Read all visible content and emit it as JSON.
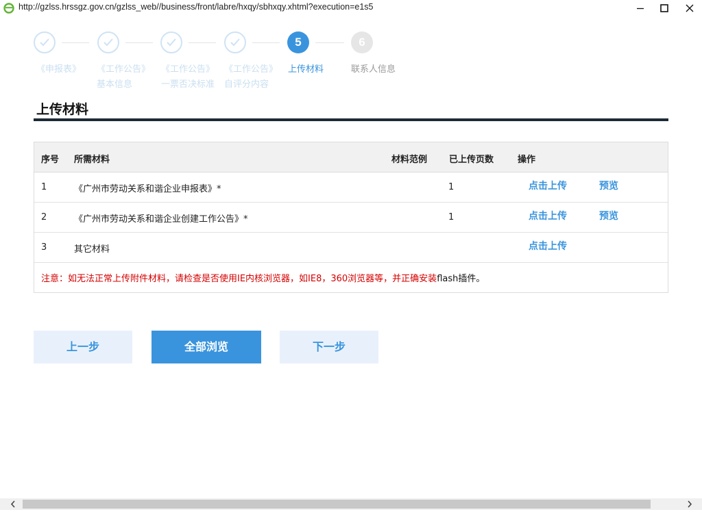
{
  "window": {
    "url": "http://gzlss.hrssgz.gov.cn/gzlss_web//business/front/labre/hxqy/sbhxqy.xhtml?execution=e1s5"
  },
  "steps": [
    {
      "number": "",
      "line1": "《申报表》",
      "line2": "",
      "state": "done"
    },
    {
      "number": "",
      "line1": "《工作公告》",
      "line2": "基本信息",
      "state": "done"
    },
    {
      "number": "",
      "line1": "《工作公告》",
      "line2": "一票否决标准",
      "state": "done"
    },
    {
      "number": "",
      "line1": "《工作公告》",
      "line2": "自评分内容",
      "state": "done"
    },
    {
      "number": "5",
      "line1": "上传材料",
      "line2": "",
      "state": "active"
    },
    {
      "number": "6",
      "line1": "联系人信息",
      "line2": "",
      "state": "todo"
    }
  ],
  "section": {
    "title": "上传材料"
  },
  "table": {
    "headers": {
      "no": "序号",
      "material": "所需材料",
      "example": "材料范例",
      "pages": "已上传页数",
      "action": "操作"
    },
    "rows": [
      {
        "no": "1",
        "material": "《广州市劳动关系和谐企业申报表》*",
        "pages": "1",
        "upload": "点击上传",
        "preview": "预览"
      },
      {
        "no": "2",
        "material": "《广州市劳动关系和谐企业创建工作公告》*",
        "pages": "1",
        "upload": "点击上传",
        "preview": "预览"
      },
      {
        "no": "3",
        "material": "其它材料",
        "pages": "",
        "upload": "点击上传",
        "preview": ""
      }
    ],
    "note_red": "注意：如无法正常上传附件材料，请检查是否使用IE内核浏览器，如IE8，360浏览器等，并正确安装",
    "note_black": "flash插件。"
  },
  "buttons": {
    "prev": "上一步",
    "browse_all": "全部浏览",
    "next": "下一步"
  },
  "colors": {
    "accent": "#3a94dd",
    "note_red": "#d40000",
    "rule": "#1c2a36"
  }
}
